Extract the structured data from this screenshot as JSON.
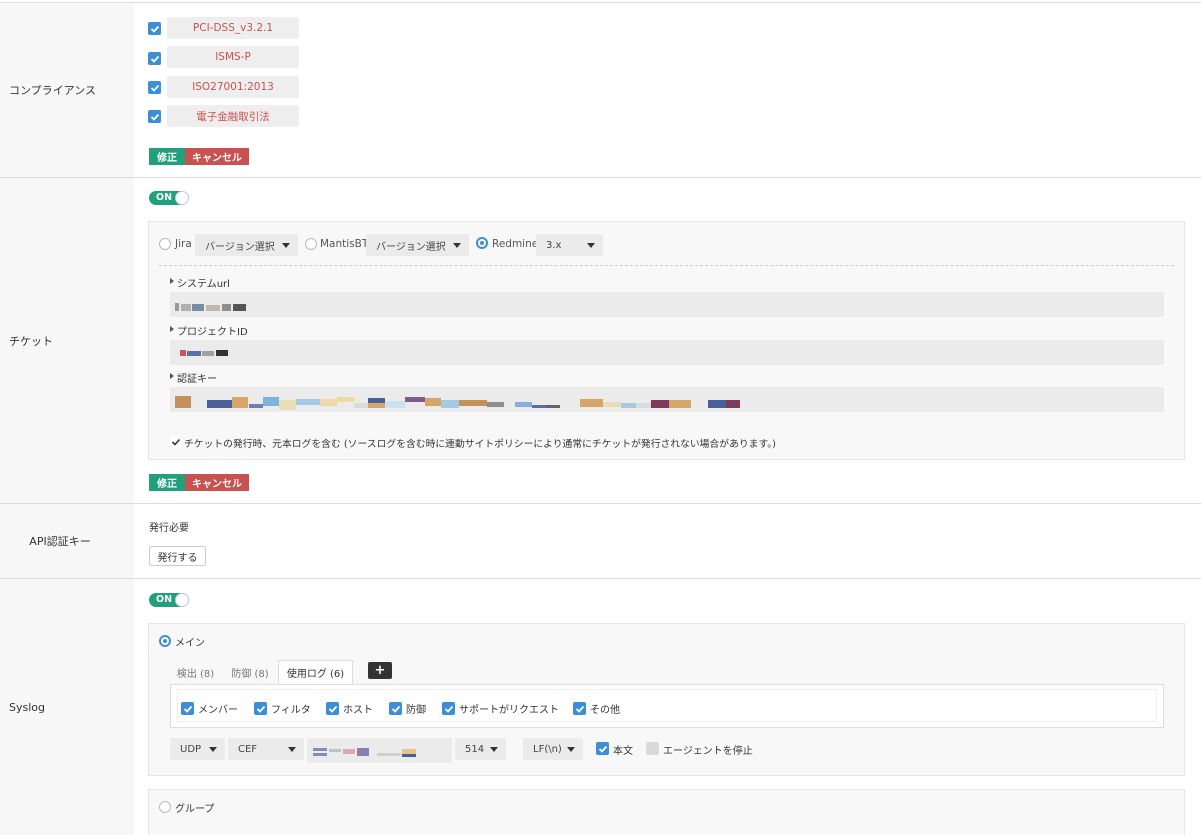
{
  "compliance": {
    "label": "コンプライアンス",
    "items": [
      "PCI-DSS_v3.2.1",
      "ISMS-P",
      "ISO27001:2013",
      "電子金融取引法"
    ],
    "edit_label": "修正",
    "cancel_label": "キャンセル"
  },
  "ticket": {
    "label": "チケット",
    "toggle_label": "ON",
    "systems": [
      {
        "name": "Jira",
        "version": "バージョン選択"
      },
      {
        "name": "MantisBT",
        "version": "バージョン選択"
      },
      {
        "name": "Redmine",
        "version": "3.x",
        "selected": true
      }
    ],
    "system_url_label": "システムurl",
    "project_id_label": "プロジェクトID",
    "auth_key_label": "認証キー",
    "include_log_label": "チケットの発行時、元本ログを含む (ソースログを含む時に連動サイトポリシーにより通常にチケットが発行されない場合があります。)",
    "edit_label": "修正",
    "cancel_label": "キャンセル"
  },
  "api": {
    "label": "API認証キー",
    "status": "発行必要",
    "issue_button": "発行する"
  },
  "syslog": {
    "label": "Syslog",
    "toggle_label": "ON",
    "main_label": "メイン",
    "group_label": "グループ",
    "tabs": [
      "検出 (8)",
      "防御 (8)",
      "使用ログ (6)"
    ],
    "add_tab": "+",
    "checks": [
      "メンバー",
      "フィルタ",
      "ホスト",
      "防御",
      "サポートがリクエスト",
      "その他"
    ],
    "protocol": "UDP",
    "format": "CEF",
    "port": "514",
    "line_end": "LF(\\n)",
    "body_label": "本文",
    "stop_agent_label": "エージェントを停止"
  }
}
